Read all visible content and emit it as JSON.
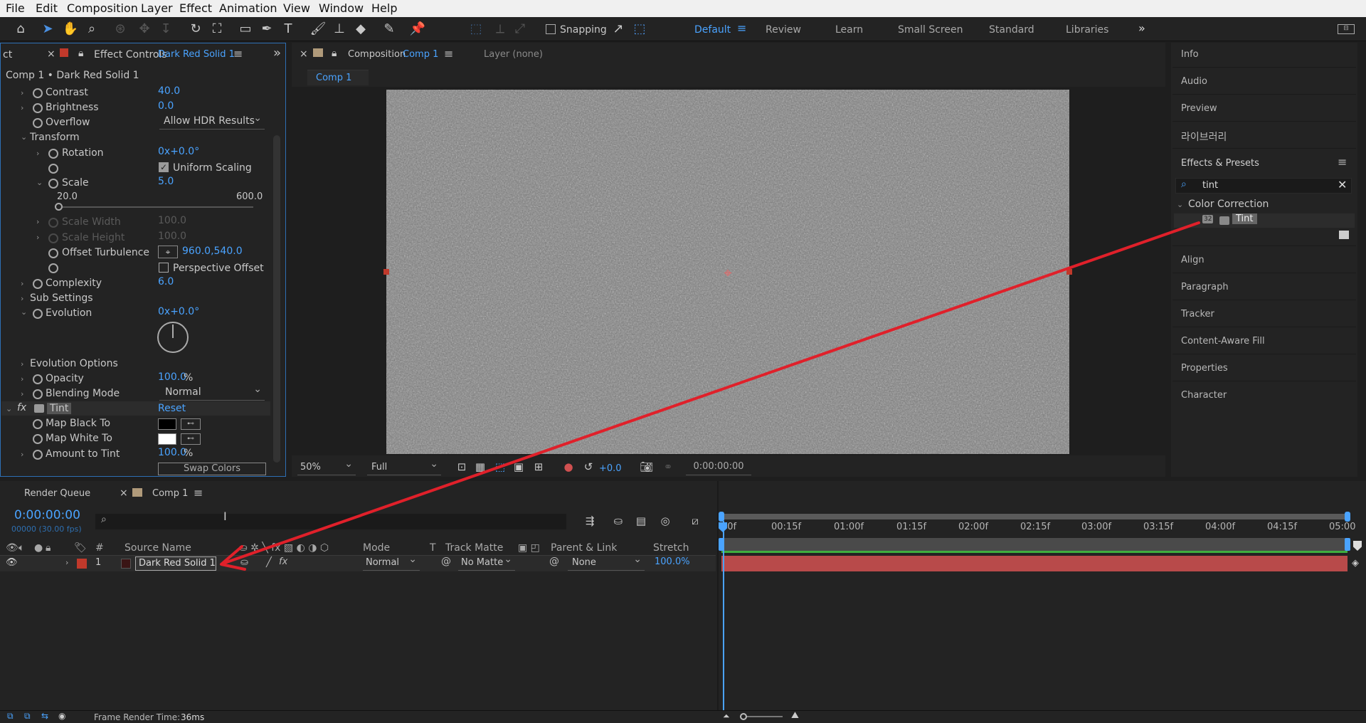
{
  "menu": [
    "File",
    "Edit",
    "Composition",
    "Layer",
    "Effect",
    "Animation",
    "View",
    "Window",
    "Help"
  ],
  "toolbar": {
    "snapping_label": "Snapping",
    "workspaces": [
      "Default",
      "Review",
      "Learn",
      "Small Screen",
      "Standard",
      "Libraries"
    ],
    "active_workspace": "Default"
  },
  "effect_controls": {
    "left_tab_fragment": "ct",
    "tab_label": "Effect Controls",
    "tab_layer": "Dark Red Solid 1",
    "breadcrumb": "Comp 1 • Dark Red Solid 1",
    "contrast": {
      "label": "Contrast",
      "value": "40.0"
    },
    "brightness": {
      "label": "Brightness",
      "value": "0.0"
    },
    "overflow": {
      "label": "Overflow",
      "value": "Allow HDR Results"
    },
    "transform": {
      "label": "Transform"
    },
    "rotation": {
      "label": "Rotation",
      "value": "0x+0.0°"
    },
    "uniform_scaling": {
      "label": "Uniform Scaling",
      "checked": true
    },
    "scale": {
      "label": "Scale",
      "value": "5.0",
      "slider_min": "20.0",
      "slider_max": "600.0",
      "slider_level": 0.0
    },
    "scale_width": {
      "label": "Scale Width",
      "value": "100.0"
    },
    "scale_height": {
      "label": "Scale Height",
      "value": "100.0"
    },
    "offset_turbulence": {
      "label": "Offset Turbulence",
      "value": "960.0,540.0"
    },
    "perspective_offset": {
      "label": "Perspective Offset",
      "checked": false
    },
    "complexity": {
      "label": "Complexity",
      "value": "6.0"
    },
    "sub_settings": {
      "label": "Sub Settings"
    },
    "evolution": {
      "label": "Evolution",
      "value": "0x+0.0°"
    },
    "evolution_options": {
      "label": "Evolution Options"
    },
    "opacity": {
      "label": "Opacity",
      "value": "100.0",
      "unit": "%"
    },
    "blending_mode": {
      "label": "Blending Mode",
      "value": "Normal"
    },
    "tint": {
      "fx": "fx",
      "label": "Tint",
      "reset": "Reset"
    },
    "map_black": {
      "label": "Map Black To",
      "color": "#000000"
    },
    "map_white": {
      "label": "Map White To",
      "color": "#ffffff"
    },
    "amount": {
      "label": "Amount to Tint",
      "value": "100.0",
      "unit": "%"
    },
    "swap_colors": "Swap Colors"
  },
  "composition": {
    "tab_label": "Composition",
    "tab_comp": "Comp 1",
    "layer_tab": "Layer (none)",
    "comp_chip": "Comp 1",
    "zoom": "50%",
    "resolution": "Full",
    "exposure": "+0.0",
    "timecode": "0:00:00:00"
  },
  "right_panels": {
    "top_items": [
      "Info",
      "Audio",
      "Preview",
      "라이브러리"
    ],
    "effects_presets": {
      "title": "Effects & Presets",
      "search_value": "tint",
      "category": "Color Correction",
      "result": "Tint",
      "result_badge": "32"
    },
    "bottom_items": [
      "Align",
      "Paragraph",
      "Tracker",
      "Content-Aware Fill",
      "Properties",
      "Character"
    ]
  },
  "timeline": {
    "render_queue_tab": "Render Queue",
    "comp_tab": "Comp 1",
    "timecode": "0:00:00:00",
    "frame_info": "00000 (30.00 fps)",
    "columns": {
      "hash": "#",
      "source_name": "Source Name",
      "mode": "Mode",
      "t": "T",
      "track_matte": "Track Matte",
      "parent_link": "Parent & Link",
      "stretch": "Stretch"
    },
    "ruler": [
      "00f",
      "00:15f",
      "01:00f",
      "01:15f",
      "02:00f",
      "02:15f",
      "03:00f",
      "03:15f",
      "04:00f",
      "04:15f",
      "05:00"
    ],
    "layer": {
      "number": "1",
      "name": "Dark Red Solid 1",
      "label_color": "#c0392b",
      "mode": "Normal",
      "track_matte": "No Matte",
      "parent": "None",
      "stretch": "100.0%",
      "fx": "fx"
    }
  },
  "statusbar": {
    "frame_render_label": "Frame Render Time:",
    "frame_render_value": "36ms"
  },
  "colors": {
    "accent": "#4aa3ff",
    "arrow": "#e0202a",
    "layer_bar": "#b84a4a"
  }
}
